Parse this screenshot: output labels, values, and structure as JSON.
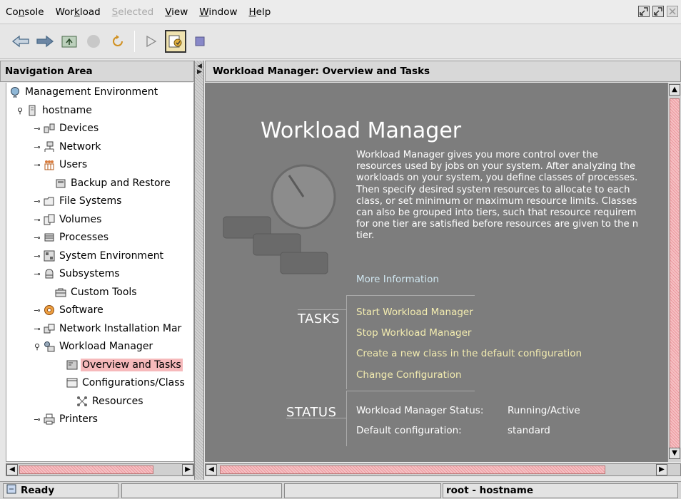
{
  "menubar": {
    "items": [
      {
        "pre": "Co",
        "u": "n",
        "post": "sole"
      },
      {
        "pre": "Wor",
        "u": "k",
        "post": "load"
      },
      {
        "pre": "",
        "u": "S",
        "post": "elected"
      },
      {
        "pre": "",
        "u": "V",
        "post": "iew"
      },
      {
        "pre": "",
        "u": "W",
        "post": "indow"
      },
      {
        "pre": "",
        "u": "H",
        "post": "elp"
      }
    ]
  },
  "nav": {
    "title": "Navigation Area",
    "tree": [
      {
        "label": "Management Environment",
        "icon": "globe-icon"
      },
      {
        "label": "hostname",
        "icon": "server-icon"
      },
      {
        "label": "Devices",
        "icon": "devices-icon"
      },
      {
        "label": "Network",
        "icon": "network-icon"
      },
      {
        "label": "Users",
        "icon": "users-icon"
      },
      {
        "label": "Backup and Restore",
        "icon": "backup-icon"
      },
      {
        "label": "File Systems",
        "icon": "folder-icon"
      },
      {
        "label": "Volumes",
        "icon": "volumes-icon"
      },
      {
        "label": "Processes",
        "icon": "processes-icon"
      },
      {
        "label": "System Environment",
        "icon": "system-icon"
      },
      {
        "label": "Subsystems",
        "icon": "subsystems-icon"
      },
      {
        "label": "Custom Tools",
        "icon": "toolbox-icon"
      },
      {
        "label": "Software",
        "icon": "software-icon"
      },
      {
        "label": "Network Installation Mar",
        "icon": "install-icon"
      },
      {
        "label": "Workload Manager",
        "icon": "workload-icon"
      },
      {
        "label": "Overview and Tasks",
        "icon": "overview-icon"
      },
      {
        "label": "Configurations/Class",
        "icon": "config-icon"
      },
      {
        "label": "Resources",
        "icon": "resources-icon"
      },
      {
        "label": "Printers",
        "icon": "printer-icon"
      }
    ]
  },
  "content": {
    "header": "Workload Manager: Overview and Tasks",
    "title": "Workload Manager",
    "description_lines": [
      "Workload Manager gives you more control over the",
      "resources used by jobs on your system. After analyzing the",
      "workloads on your system, you define classes of processes.",
      "Then specify desired system resources to allocate to each",
      "class, or set minimum or maximum resource limits. Classes",
      "can also be grouped into tiers, such that resource requirem",
      "for one tier are satisfied before resources are given to the n",
      "tier."
    ],
    "more_info": "More Information",
    "tasks_label": "TASKS",
    "tasks": [
      "Start Workload Manager",
      "Stop Workload Manager",
      "Create a new class in the default configuration",
      "Change Configuration"
    ],
    "status_label": "STATUS",
    "status": [
      {
        "label": "Workload Manager Status:",
        "value": "Running/Active"
      },
      {
        "label": "Default configuration:",
        "value": "standard"
      }
    ]
  },
  "statusbar": {
    "ready": "Ready",
    "user": "root - hostname"
  }
}
